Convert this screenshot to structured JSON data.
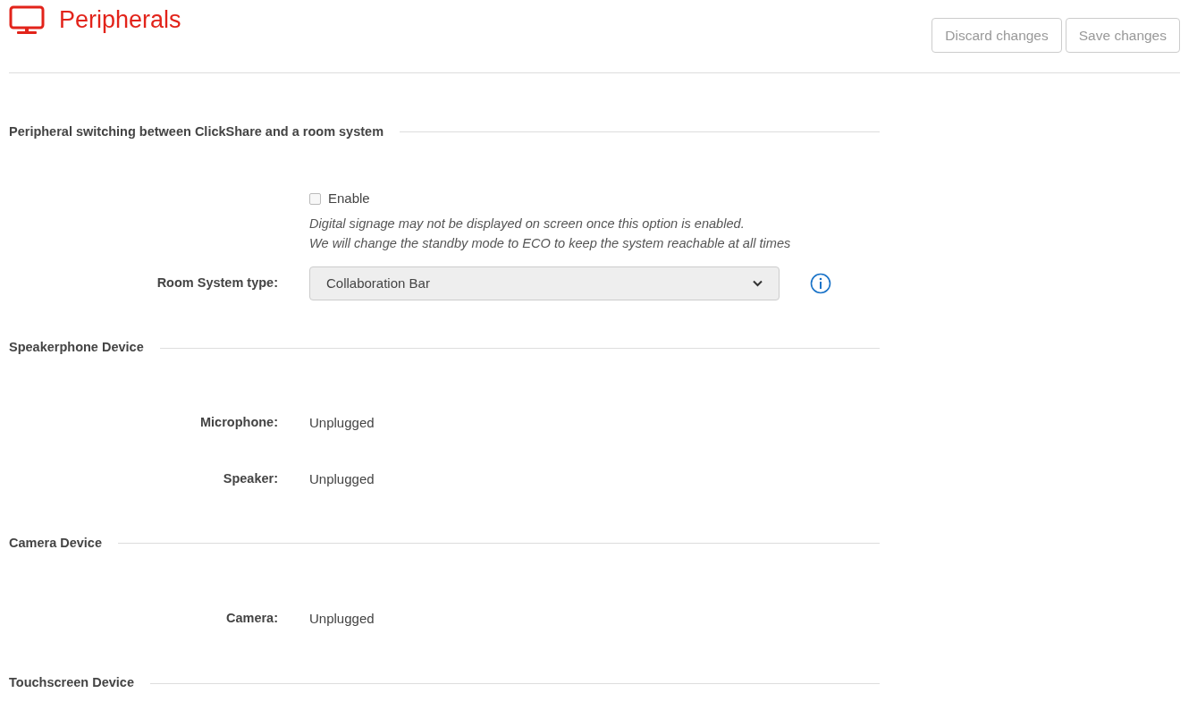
{
  "header": {
    "title": "Peripherals",
    "buttons": [
      {
        "label": "Discard changes",
        "disabled": true
      },
      {
        "label": "Save changes",
        "disabled": true
      }
    ]
  },
  "sections": [
    {
      "title": "Peripheral switching between ClickShare and a room system",
      "kind": "switching",
      "enable": {
        "label": "Enable",
        "checked": false
      },
      "notes": [
        "Digital signage may not be displayed on screen once this option is enabled.",
        "We will change the standby mode to ECO to keep the system reachable at all times"
      ],
      "select": {
        "label": "Room System type:",
        "value": "Collaboration Bar"
      }
    },
    {
      "title": "Speakerphone Device",
      "kind": "status",
      "rows": [
        {
          "label": "Microphone:",
          "value": "Unplugged"
        },
        {
          "label": "Speaker:",
          "value": "Unplugged"
        }
      ]
    },
    {
      "title": "Camera Device",
      "kind": "status",
      "rows": [
        {
          "label": "Camera:",
          "value": "Unplugged"
        }
      ]
    },
    {
      "title": "Touchscreen Device",
      "kind": "status"
    }
  ]
}
